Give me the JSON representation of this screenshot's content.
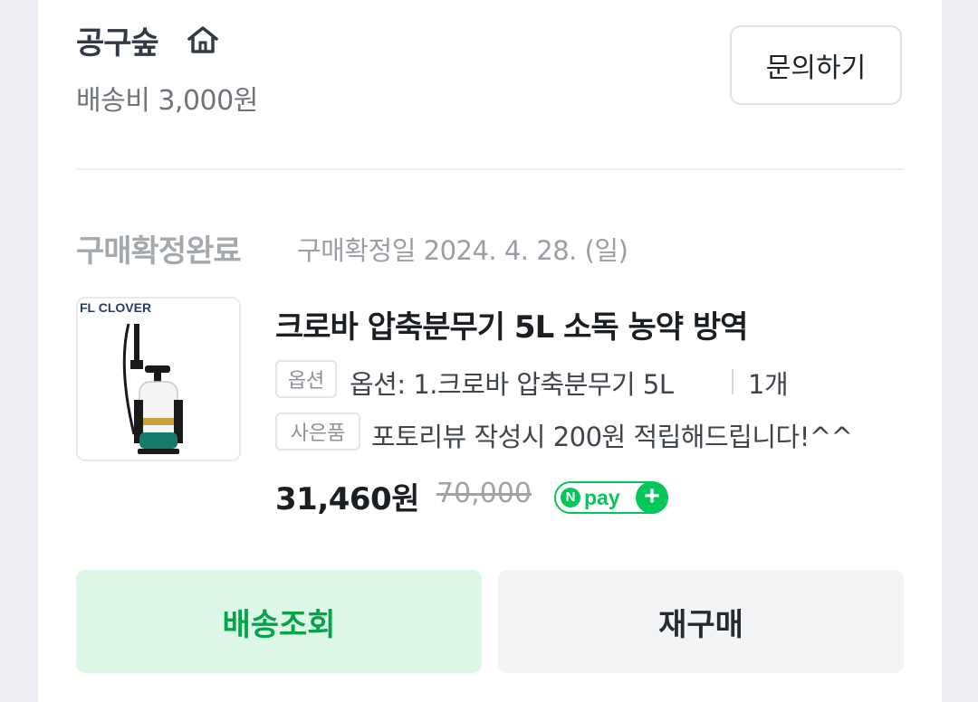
{
  "store": {
    "name": "공구숲",
    "home_icon": "home-icon",
    "shipping_fee": "배송비 3,000원",
    "inquiry_label": "문의하기"
  },
  "order": {
    "status": "구매확정완료",
    "confirm_date": "구매확정일 2024. 4. 28. (일)"
  },
  "product": {
    "image_logo": "FL CLOVER",
    "title": "크로바 압축분무기 5L 소독 농약 방역",
    "option_tag": "옵션",
    "option_value": "옵션: 1.크로바 압축분무기 5L",
    "quantity": "1개",
    "gift_tag": "사은품",
    "gift_value": "포토리뷰 작성시 200원 적립해드립니다!^^",
    "price": "31,460원",
    "original_price": "70,000",
    "npay_badge": {
      "n": "N",
      "label": "pay",
      "plus": "+"
    }
  },
  "actions": {
    "track_label": "배송조회",
    "rebuy_label": "재구매"
  },
  "colors": {
    "accent_green": "#03c75a",
    "track_bg": "#dcf7e6",
    "track_text": "#07a34b"
  }
}
